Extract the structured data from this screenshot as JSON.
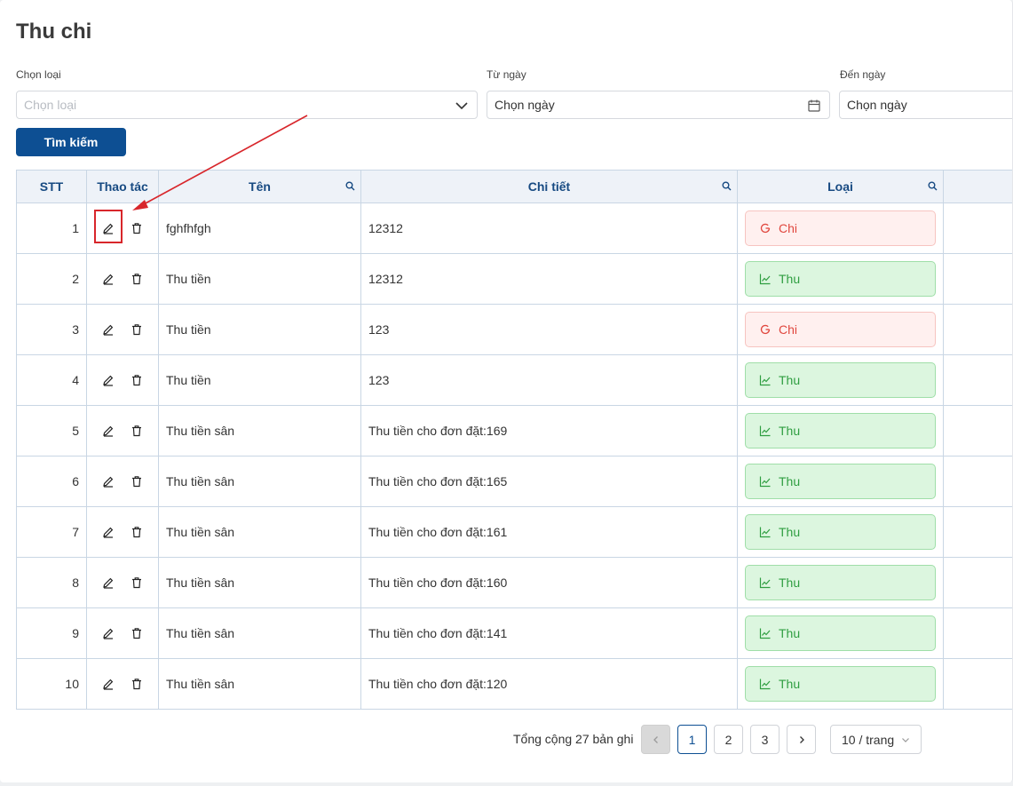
{
  "page": {
    "title": "Thu chi"
  },
  "filters": {
    "type": {
      "label": "Chọn loại",
      "placeholder": "Chọn loại"
    },
    "from": {
      "label": "Từ ngày",
      "value": "Chọn ngày"
    },
    "to": {
      "label": "Đến ngày",
      "value": "Chọn ngày"
    },
    "search_label": "Tìm kiếm"
  },
  "table": {
    "columns": [
      "STT",
      "Thao tác",
      "Tên",
      "Chi tiết",
      "Loại"
    ],
    "rows": [
      {
        "stt": "1",
        "name": "fghfhfgh",
        "detail": "12312",
        "type": "Chi"
      },
      {
        "stt": "2",
        "name": "Thu tiền",
        "detail": "12312",
        "type": "Thu"
      },
      {
        "stt": "3",
        "name": "Thu tiền",
        "detail": "123",
        "type": "Chi"
      },
      {
        "stt": "4",
        "name": "Thu tiền",
        "detail": "123",
        "type": "Thu"
      },
      {
        "stt": "5",
        "name": "Thu tiền sân",
        "detail": "Thu tiền cho đơn đặt:169",
        "type": "Thu"
      },
      {
        "stt": "6",
        "name": "Thu tiền sân",
        "detail": "Thu tiền cho đơn đặt:165",
        "type": "Thu"
      },
      {
        "stt": "7",
        "name": "Thu tiền sân",
        "detail": "Thu tiền cho đơn đặt:161",
        "type": "Thu"
      },
      {
        "stt": "8",
        "name": "Thu tiền sân",
        "detail": "Thu tiền cho đơn đặt:160",
        "type": "Thu"
      },
      {
        "stt": "9",
        "name": "Thu tiền sân",
        "detail": "Thu tiền cho đơn đặt:141",
        "type": "Thu"
      },
      {
        "stt": "10",
        "name": "Thu tiền sân",
        "detail": "Thu tiền cho đơn đặt:120",
        "type": "Thu"
      }
    ]
  },
  "pagination": {
    "total_text": "Tổng cộng 27 bản ghi",
    "pages": [
      "1",
      "2",
      "3"
    ],
    "current": "1",
    "page_size": "10 / trang"
  },
  "colors": {
    "primary": "#0d4f93",
    "chi": "#e0473e",
    "thu": "#2f9e41",
    "annotation": "#d8262b"
  }
}
